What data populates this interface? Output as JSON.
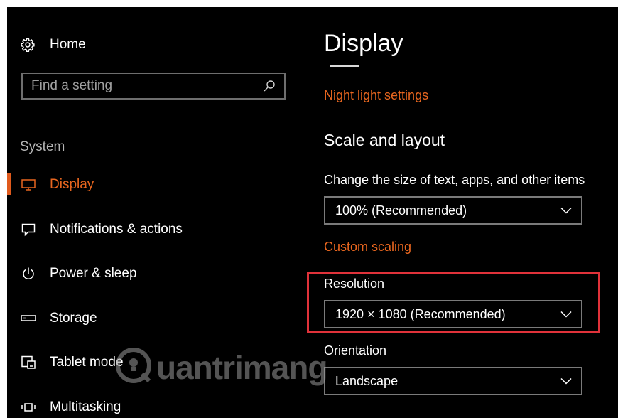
{
  "sidebar": {
    "home_label": "Home",
    "search": {
      "placeholder": "Find a setting",
      "value": ""
    },
    "section_title": "System",
    "items": [
      {
        "label": "Display",
        "icon": "monitor-icon",
        "active": true
      },
      {
        "label": "Notifications & actions",
        "icon": "message-icon",
        "active": false
      },
      {
        "label": "Power & sleep",
        "icon": "power-icon",
        "active": false
      },
      {
        "label": "Storage",
        "icon": "storage-icon",
        "active": false
      },
      {
        "label": "Tablet mode",
        "icon": "tablet-mode-icon",
        "active": false
      },
      {
        "label": "Multitasking",
        "icon": "multitasking-icon",
        "active": false
      }
    ]
  },
  "main": {
    "title": "Display",
    "night_light_link": "Night light settings",
    "scale_heading": "Scale and layout",
    "scale_label": "Change the size of text, apps, and other items",
    "scale_value": "100% (Recommended)",
    "custom_scaling_link": "Custom scaling",
    "resolution_label": "Resolution",
    "resolution_value": "1920 × 1080 (Recommended)",
    "orientation_label": "Orientation",
    "orientation_value": "Landscape"
  },
  "watermark": {
    "text": "uantrimang"
  },
  "colors": {
    "background": "#000000",
    "accent": "#e8661f",
    "highlight": "#e0323a",
    "text": "#ffffff"
  }
}
